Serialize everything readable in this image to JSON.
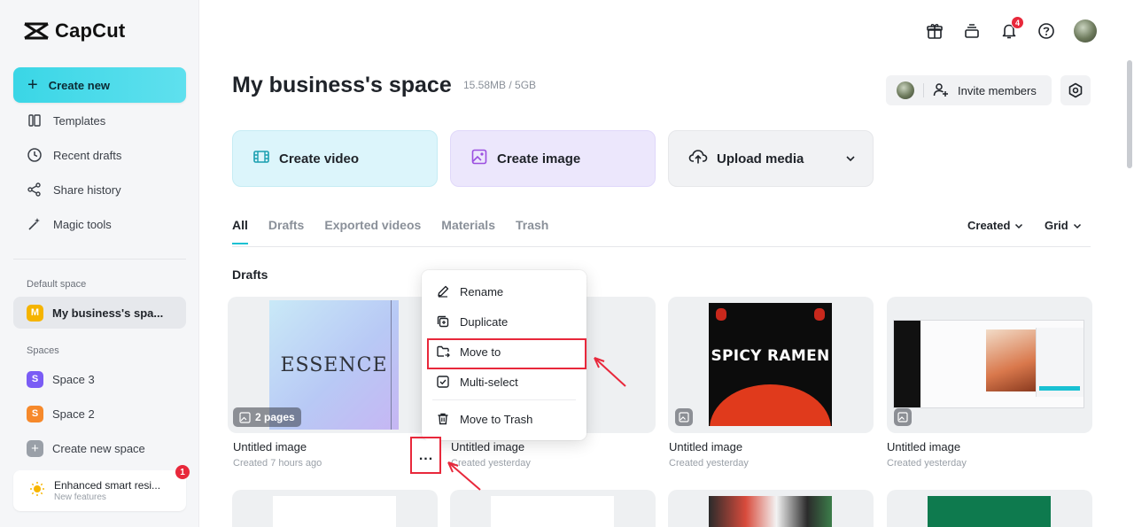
{
  "app": {
    "name": "CapCut"
  },
  "sidebar": {
    "create_new": "Create new",
    "nav": [
      {
        "label": "Templates",
        "icon": "templates-icon"
      },
      {
        "label": "Recent drafts",
        "icon": "clock-icon"
      },
      {
        "label": "Share history",
        "icon": "share-icon"
      },
      {
        "label": "Magic tools",
        "icon": "magic-wand-icon"
      }
    ],
    "default_space_label": "Default space",
    "default_space": {
      "letter": "M",
      "name": "My business's spa...",
      "color": "#f5b400"
    },
    "spaces_label": "Spaces",
    "spaces": [
      {
        "letter": "S",
        "name": "Space 3",
        "color": "#7a5cf5"
      },
      {
        "letter": "S",
        "name": "Space 2",
        "color": "#f6892b"
      }
    ],
    "create_space": "Create new space",
    "promo": {
      "title": "Enhanced smart resi...",
      "subtitle": "New features",
      "count": "1"
    }
  },
  "topbar": {
    "notification_count": "4"
  },
  "header": {
    "title": "My business's space",
    "storage": "15.58MB / 5GB",
    "invite": "Invite members"
  },
  "actions": {
    "video": "Create video",
    "image": "Create image",
    "upload": "Upload media"
  },
  "tabs": [
    "All",
    "Drafts",
    "Exported videos",
    "Materials",
    "Trash"
  ],
  "sort": {
    "order": "Created",
    "view": "Grid"
  },
  "section": "Drafts",
  "cards": [
    {
      "name": "Untitled image",
      "meta": "Created 7 hours ago",
      "pages": "2 pages",
      "thumb_text": "ESSENCE"
    },
    {
      "name": "Untitled image",
      "meta": "Created yesterday"
    },
    {
      "name": "Untitled image",
      "meta": "Created yesterday",
      "thumb_text": "SPICY RAMEN"
    },
    {
      "name": "Untitled image",
      "meta": "Created yesterday"
    }
  ],
  "menu": {
    "items": [
      "Rename",
      "Duplicate",
      "Move to",
      "Multi-select",
      "Move to Trash"
    ],
    "more": "..."
  },
  "colors": {
    "accent": "#19c1d3",
    "highlight": "#e8283b"
  }
}
